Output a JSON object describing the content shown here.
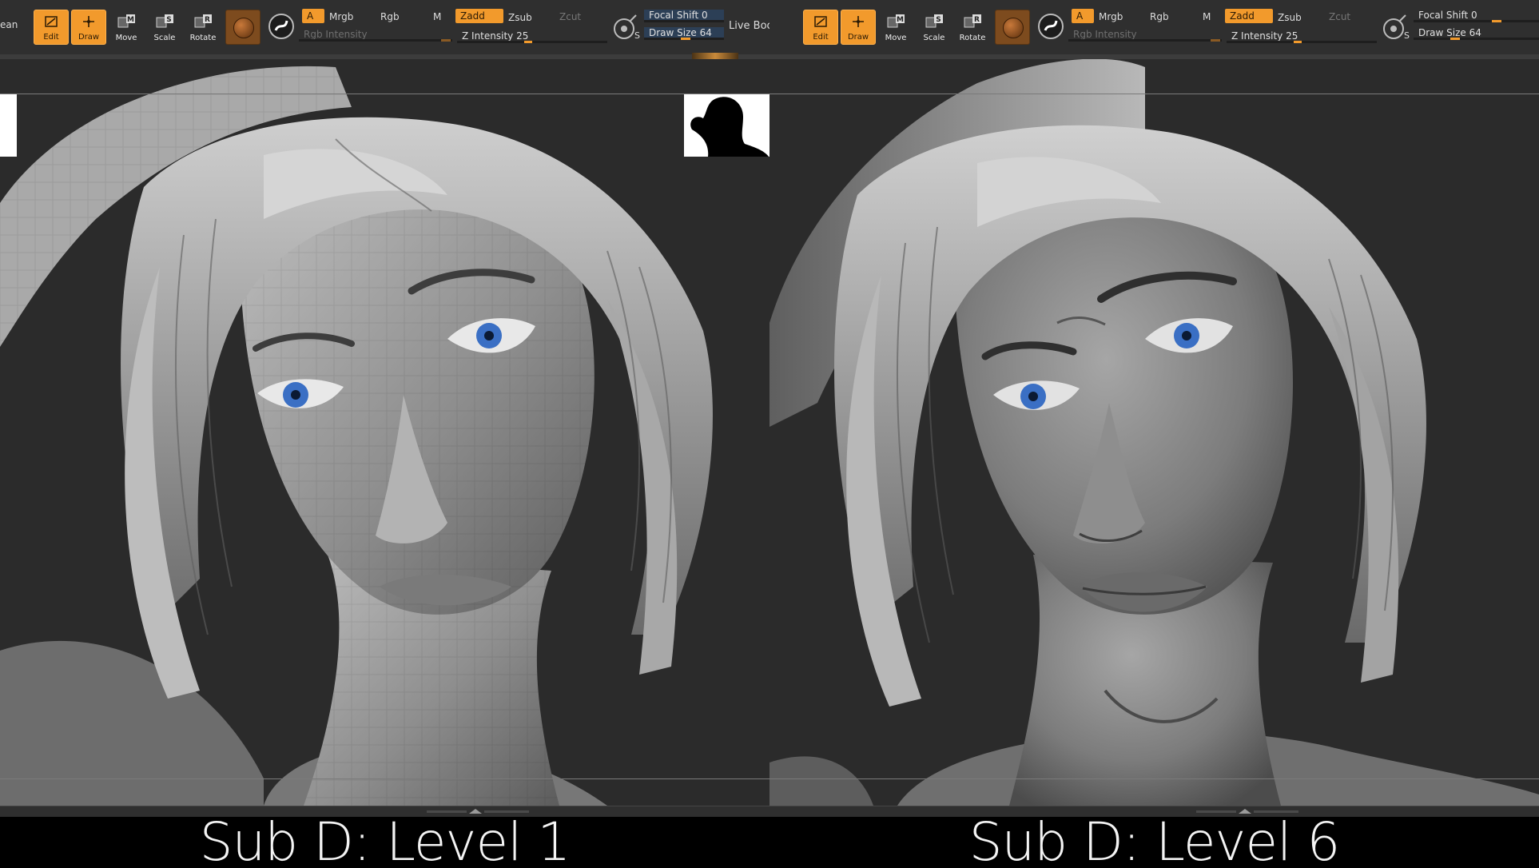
{
  "panels": [
    {
      "id": "left",
      "edge_label": "ean",
      "tools": {
        "edit": "Edit",
        "draw": "Draw",
        "move": "Move",
        "scale": "Scale",
        "rotate": "Rotate",
        "move_key": "M",
        "scale_key": "S",
        "rotate_key": "R"
      },
      "modes": {
        "a": "A",
        "mrgb": "Mrgb",
        "rgb": "Rgb",
        "m": "M",
        "zadd": "Zadd",
        "zsub": "Zsub",
        "zcut": "Zcut"
      },
      "rgb_intensity_label": "Rgb Intensity",
      "z_intensity": {
        "label": "Z Intensity 25",
        "value": 25
      },
      "focal_shift": {
        "label": "Focal Shift 0",
        "value": 0
      },
      "draw_size": {
        "label": "Draw Size 64",
        "value": 64
      },
      "live_boolean": "Live Boolean",
      "sd_icon_letter": "S",
      "caption": "Sub D: Level 1"
    },
    {
      "id": "right",
      "tools": {
        "edit": "Edit",
        "draw": "Draw",
        "move": "Move",
        "scale": "Scale",
        "rotate": "Rotate",
        "move_key": "M",
        "scale_key": "S",
        "rotate_key": "R"
      },
      "modes": {
        "a": "A",
        "mrgb": "Mrgb",
        "rgb": "Rgb",
        "m": "M",
        "zadd": "Zadd",
        "zsub": "Zsub",
        "zcut": "Zcut"
      },
      "rgb_intensity_label": "Rgb Intensity",
      "z_intensity": {
        "label": "Z Intensity 25",
        "value": 25
      },
      "focal_shift": {
        "label": "Focal Shift 0",
        "value": 0
      },
      "draw_size": {
        "label": "Draw Size 64",
        "value": 64
      },
      "sd_icon_letter": "S",
      "caption": "Sub D: Level 6"
    }
  ],
  "colors": {
    "accent": "#f29a2c",
    "toolbar": "#2f2f2f",
    "viewport": "#2b2b2b",
    "caption_bg": "#000000",
    "caption_text": "#f4f4f4",
    "sculpt": "#9a9a9a",
    "eye": "#3a6fc4"
  },
  "icons": [
    "edit-icon",
    "draw-icon",
    "move-icon",
    "scale-icon",
    "rotate-icon",
    "material-sphere-icon",
    "stroke-icon",
    "sd-lightbox-icon",
    "silhouette-thumbnail"
  ]
}
